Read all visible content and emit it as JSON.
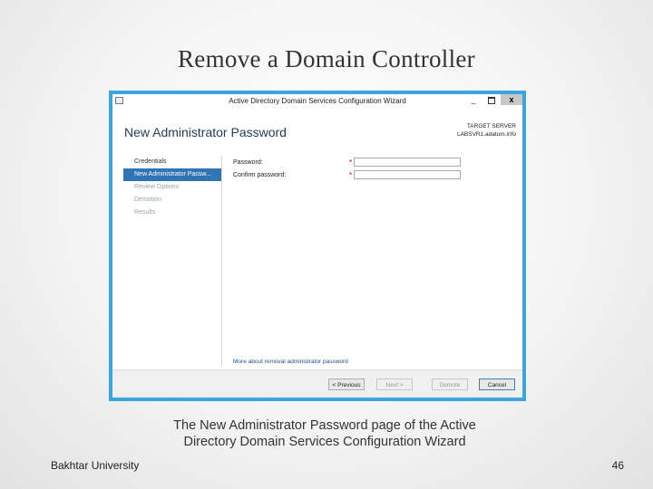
{
  "slide": {
    "title": "Remove a Domain Controller",
    "caption_line1": "The New Administrator Password page of the Active",
    "caption_line2": "Directory Domain Services Configuration Wizard",
    "footer_left": "Bakhtar University",
    "page_number": "46"
  },
  "window": {
    "title": "Active Directory Domain Services Configuration Wizard",
    "minimize": "_",
    "close": "x"
  },
  "page": {
    "heading": "New Administrator Password",
    "target_label": "TARGET SERVER",
    "target_server": "LABSVR1.adatum.info"
  },
  "nav": {
    "items": [
      {
        "label": "Credentials",
        "state": "done"
      },
      {
        "label": "New Administrator Passw...",
        "state": "active"
      },
      {
        "label": "Review Options",
        "state": "disabled"
      },
      {
        "label": "Demotion",
        "state": "disabled"
      },
      {
        "label": "Results",
        "state": "disabled"
      }
    ]
  },
  "form": {
    "password_label": "Password:",
    "confirm_label": "Confirm password:",
    "required_marker": "*",
    "password_value": "",
    "confirm_value": "",
    "more_link": "More about removal administrator password"
  },
  "buttons": {
    "previous": "< Previous",
    "next": "Next >",
    "demote": "Demote",
    "cancel": "Cancel"
  },
  "colors": {
    "window_border": "#3aa6dd",
    "nav_active": "#2f74b4",
    "heading": "#1e3b5a"
  }
}
